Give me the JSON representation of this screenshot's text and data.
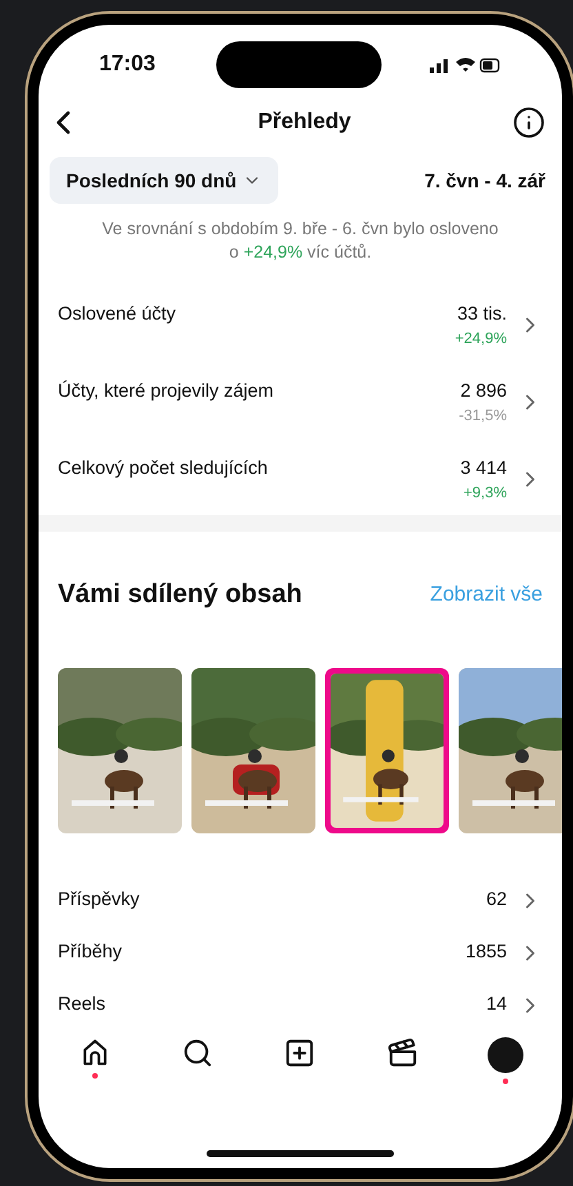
{
  "status_bar": {
    "time": "17:03"
  },
  "header": {
    "title": "Přehledy"
  },
  "period": {
    "label": "Posledních 90 dnů",
    "range": "7. čvn - 4. zář"
  },
  "comparison": {
    "text": "Ve srovnání s obdobím 9. bře - 6. čvn bylo osloveno o ",
    "delta": "+24,9%",
    "suffix": " víc účtů."
  },
  "metrics": [
    {
      "label": "Oslovené účty",
      "value": "33 tis.",
      "delta": "+24,9%",
      "positive": true
    },
    {
      "label": "Účty, které projevily zájem",
      "value": "2 896",
      "delta": "-31,5%",
      "positive": false
    },
    {
      "label": "Celkový počet sledujících",
      "value": "3 414",
      "delta": "+9,3%",
      "positive": true
    }
  ],
  "shared": {
    "title": "Vámi sdílený obsah",
    "link": "Zobrazit vše",
    "items": [
      {
        "kind": "picture",
        "highlighted": false
      },
      {
        "kind": "picture",
        "highlighted": false
      },
      {
        "kind": "picture",
        "highlighted": true
      },
      {
        "kind": "picture",
        "highlighted": false
      }
    ]
  },
  "content_rows": [
    {
      "label": "Příspěvky",
      "value": "62"
    },
    {
      "label": "Příběhy",
      "value": "1855"
    },
    {
      "label": "Reels",
      "value": "14"
    }
  ],
  "tab_bar": [
    {
      "kind": "home",
      "badge": true
    },
    {
      "kind": "search",
      "badge": false
    },
    {
      "kind": "create",
      "badge": false
    },
    {
      "kind": "reels",
      "badge": false
    },
    {
      "kind": "profile",
      "badge": true
    }
  ]
}
